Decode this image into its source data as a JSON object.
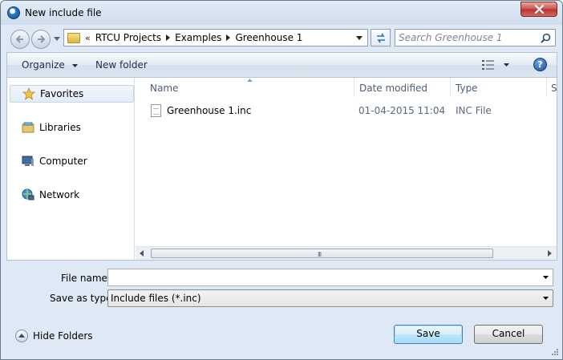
{
  "window": {
    "title": "New include file"
  },
  "address_bar": {
    "overflow": "«",
    "crumbs": [
      "RTCU Projects",
      "Examples",
      "Greenhouse 1"
    ]
  },
  "search": {
    "placeholder": "Search Greenhouse 1"
  },
  "toolbar": {
    "organize": "Organize",
    "new_folder": "New folder",
    "help": "?"
  },
  "nav_pane": {
    "items": [
      {
        "label": "Favorites",
        "icon": "star-icon",
        "selected": true
      },
      {
        "label": "Libraries",
        "icon": "library-icon"
      },
      {
        "label": "Computer",
        "icon": "computer-icon"
      },
      {
        "label": "Network",
        "icon": "network-icon"
      }
    ]
  },
  "file_list": {
    "columns": [
      "Name",
      "Date modified",
      "Type",
      "Si"
    ],
    "sort_column": "Name",
    "rows": [
      {
        "name": "Greenhouse 1.inc",
        "date": "01-04-2015 11:04",
        "type": "INC File"
      }
    ]
  },
  "scrollbar": {
    "grip": "III"
  },
  "form": {
    "file_name_label": "File name:",
    "file_name_value": "",
    "save_type_label": "Save as type:",
    "save_type_value": "Include files (*.inc)"
  },
  "footer": {
    "hide_folders": "Hide Folders",
    "save": "Save",
    "cancel": "Cancel"
  },
  "colors": {
    "frame": "#dfe9f5",
    "toolbar_text": "#1b2f4a",
    "column_header": "#4c607a",
    "close_button": "#c75050",
    "primary_button_border": "#3c7fb1"
  }
}
